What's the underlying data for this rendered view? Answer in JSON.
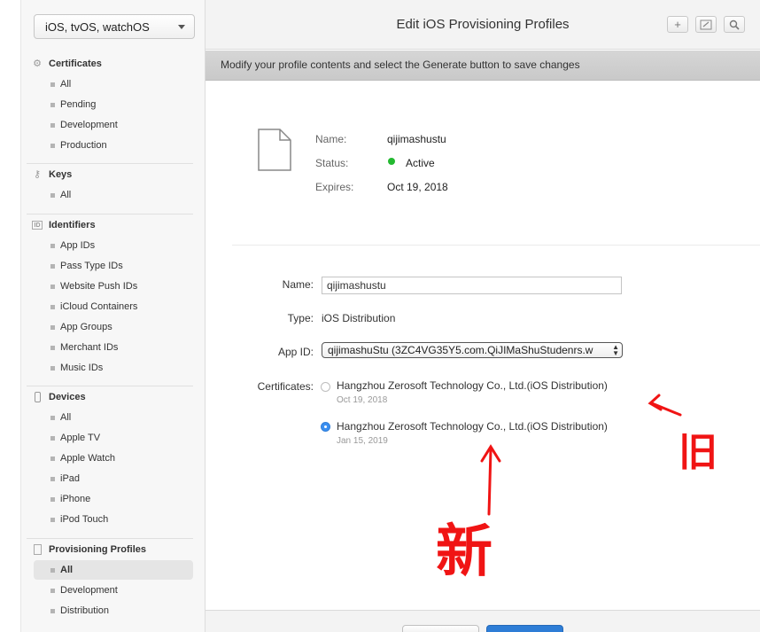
{
  "sidebar": {
    "platform": "iOS, tvOS, watchOS",
    "sections": [
      {
        "title": "Certificates",
        "icon": "certificate-icon",
        "items": [
          "All",
          "Pending",
          "Development",
          "Production"
        ]
      },
      {
        "title": "Keys",
        "icon": "key-icon",
        "items": [
          "All"
        ]
      },
      {
        "title": "Identifiers",
        "icon": "id-icon",
        "items": [
          "App IDs",
          "Pass Type IDs",
          "Website Push IDs",
          "iCloud Containers",
          "App Groups",
          "Merchant IDs",
          "Music IDs"
        ]
      },
      {
        "title": "Devices",
        "icon": "device-icon",
        "items": [
          "All",
          "Apple TV",
          "Apple Watch",
          "iPad",
          "iPhone",
          "iPod Touch"
        ]
      },
      {
        "title": "Provisioning Profiles",
        "icon": "document-icon",
        "items": [
          "All",
          "Development",
          "Distribution"
        ],
        "active": "All"
      }
    ]
  },
  "header": {
    "title": "Edit iOS Provisioning Profiles",
    "buttons": [
      "add-icon",
      "edit-icon",
      "search-icon"
    ]
  },
  "banner": "Modify your profile contents and select the Generate button to save changes",
  "summary": {
    "name_label": "Name:",
    "name": "qijimashustu",
    "status_label": "Status:",
    "status": "Active",
    "status_color": "#23b930",
    "expires_label": "Expires:",
    "expires": "Oct 19, 2018"
  },
  "form": {
    "name_label": "Name:",
    "name_value": "qijimashustu",
    "type_label": "Type:",
    "type_value": "iOS Distribution",
    "appid_label": "App ID:",
    "appid_value": "qijimashuStu (3ZC4VG35Y5.com.QiJIMaShuStudenrs.w",
    "certificates_label": "Certificates:",
    "certificates": [
      {
        "name": "Hangzhou Zerosoft Technology Co., Ltd.(iOS Distribution)",
        "date": "Oct 19, 2018",
        "selected": false
      },
      {
        "name": "Hangzhou Zerosoft Technology Co., Ltd.(iOS Distribution)",
        "date": "Jan 15, 2019",
        "selected": true
      }
    ]
  },
  "annotations": {
    "old": "旧",
    "new": "新",
    "color": "#f01414"
  },
  "colors": {
    "accent": "#2e7dd6"
  }
}
